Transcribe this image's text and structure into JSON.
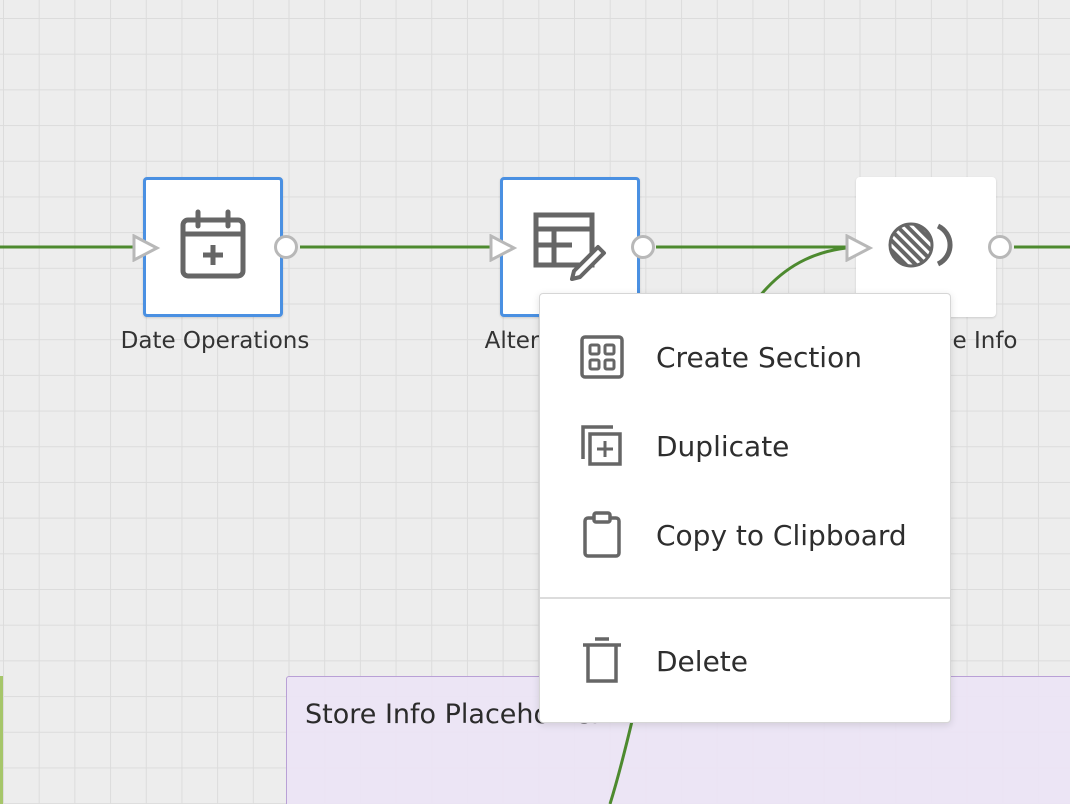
{
  "canvas": {
    "edge_color": "#4d8a2f",
    "selection_color": "#4a90e2"
  },
  "nodes": [
    {
      "label": "Date Operations",
      "icon": "calendar-plus-icon",
      "selected": true
    },
    {
      "label": "Alter",
      "icon": "table-edit-icon",
      "selected": true
    },
    {
      "label": "e Info",
      "icon": "circles-icon",
      "selected": false
    }
  ],
  "section": {
    "title": "Store Info Placeholder"
  },
  "context_menu": {
    "items": [
      {
        "label": "Create Section",
        "icon": "grid-section-icon"
      },
      {
        "label": "Duplicate",
        "icon": "duplicate-icon"
      },
      {
        "label": "Copy to Clipboard",
        "icon": "clipboard-icon"
      },
      {
        "label": "Delete",
        "icon": "trash-icon"
      }
    ]
  }
}
